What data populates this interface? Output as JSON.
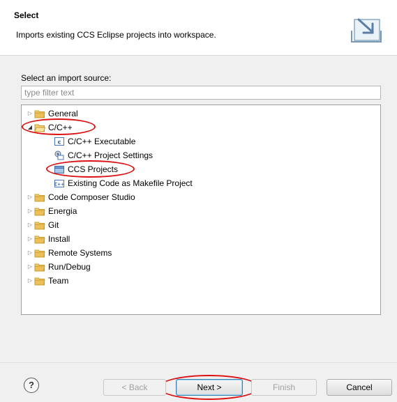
{
  "header": {
    "title": "Select",
    "description": "Imports existing CCS Eclipse projects into workspace."
  },
  "source": {
    "label": "Select an import source:",
    "filter_placeholder": "type filter text"
  },
  "tree": {
    "items": [
      {
        "label": "General",
        "expanded": false,
        "icon": "folder-icon"
      },
      {
        "label": "C/C++",
        "expanded": true,
        "icon": "folder-icon",
        "children": [
          {
            "label": "C/C++ Executable",
            "icon": "c-file-icon"
          },
          {
            "label": "C/C++ Project Settings",
            "icon": "project-settings-icon"
          },
          {
            "label": "CCS Projects",
            "icon": "ccs-project-icon"
          },
          {
            "label": "Existing Code as Makefile Project",
            "icon": "makefile-icon"
          }
        ]
      },
      {
        "label": "Code Composer Studio",
        "expanded": false,
        "icon": "folder-icon"
      },
      {
        "label": "Energia",
        "expanded": false,
        "icon": "folder-icon"
      },
      {
        "label": "Git",
        "expanded": false,
        "icon": "folder-icon"
      },
      {
        "label": "Install",
        "expanded": false,
        "icon": "folder-icon"
      },
      {
        "label": "Remote Systems",
        "expanded": false,
        "icon": "folder-icon"
      },
      {
        "label": "Run/Debug",
        "expanded": false,
        "icon": "folder-icon"
      },
      {
        "label": "Team",
        "expanded": false,
        "icon": "folder-icon"
      }
    ]
  },
  "buttons": {
    "help": "?",
    "back": "< Back",
    "next": "Next >",
    "finish": "Finish",
    "cancel": "Cancel"
  },
  "colors": {
    "highlight_ring": "#dd1111",
    "folder": "#e8b84a"
  }
}
